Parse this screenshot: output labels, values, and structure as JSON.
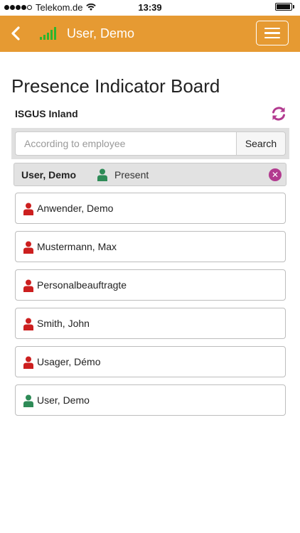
{
  "status_bar": {
    "carrier": "Telekom.de",
    "time": "13:39",
    "signal_dots_filled": 4,
    "signal_dots_total": 5,
    "battery_level": 0.95
  },
  "header": {
    "back_icon": "chevron-left-icon",
    "signal_icon": "signal-bars-icon",
    "title": "User, Demo",
    "menu_icon": "hamburger-icon"
  },
  "page": {
    "title": "Presence Indicator Board",
    "org_name": "ISGUS Inland",
    "refresh_icon": "refresh-icon"
  },
  "search": {
    "placeholder": "According to employee",
    "value": "",
    "button_label": "Search"
  },
  "current_user": {
    "name": "User, Demo",
    "status": "Present",
    "status_color": "#2e8b57",
    "clear_icon": "close-circle-icon"
  },
  "colors": {
    "header_bg": "#e69a32",
    "present": "#2e8b57",
    "absent": "#cc1f1f",
    "accent": "#b23a8f"
  },
  "employees": [
    {
      "name": "Anwender, Demo",
      "status": "absent"
    },
    {
      "name": "Mustermann, Max",
      "status": "absent"
    },
    {
      "name": "Personalbeauftragte",
      "status": "absent"
    },
    {
      "name": "Smith, John",
      "status": "absent"
    },
    {
      "name": "Usager, Démo",
      "status": "absent"
    },
    {
      "name": "User, Demo",
      "status": "present"
    }
  ]
}
